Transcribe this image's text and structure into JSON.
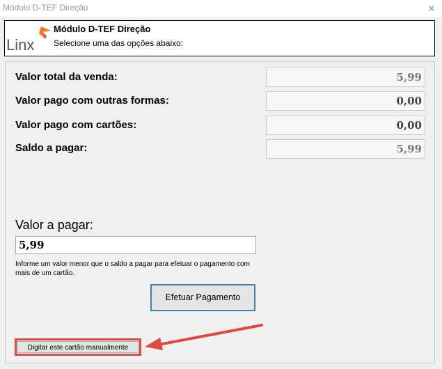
{
  "window": {
    "title": "Módulo D-TEF Direção",
    "close_glyph": "✕"
  },
  "header": {
    "logo_text": "Linx",
    "title": "Módulo D-TEF Direção",
    "subtitle": "Selecione uma das opções abaixo:"
  },
  "summary": {
    "rows": [
      {
        "label": "Valor total da venda:",
        "value": "5,99"
      },
      {
        "label": "Valor pago com outras formas:",
        "value": "0,00"
      },
      {
        "label": "Valor pago com cartões:",
        "value": "0,00"
      },
      {
        "label": "Saldo a pagar:",
        "value": "5,99"
      }
    ]
  },
  "payment": {
    "label": "Valor a pagar:",
    "value": "5,99",
    "info": "Informe um valor menor que o saldo a pagar para efetuar o pagamento com mais de um cartão.",
    "button_label": "Efetuar Pagamento"
  },
  "manual": {
    "button_label": "Digitar este cartão manualmente"
  },
  "colors": {
    "annotation": "#e04a3f",
    "logo_accent": "#f47920",
    "button_border": "#3c7fb1"
  }
}
